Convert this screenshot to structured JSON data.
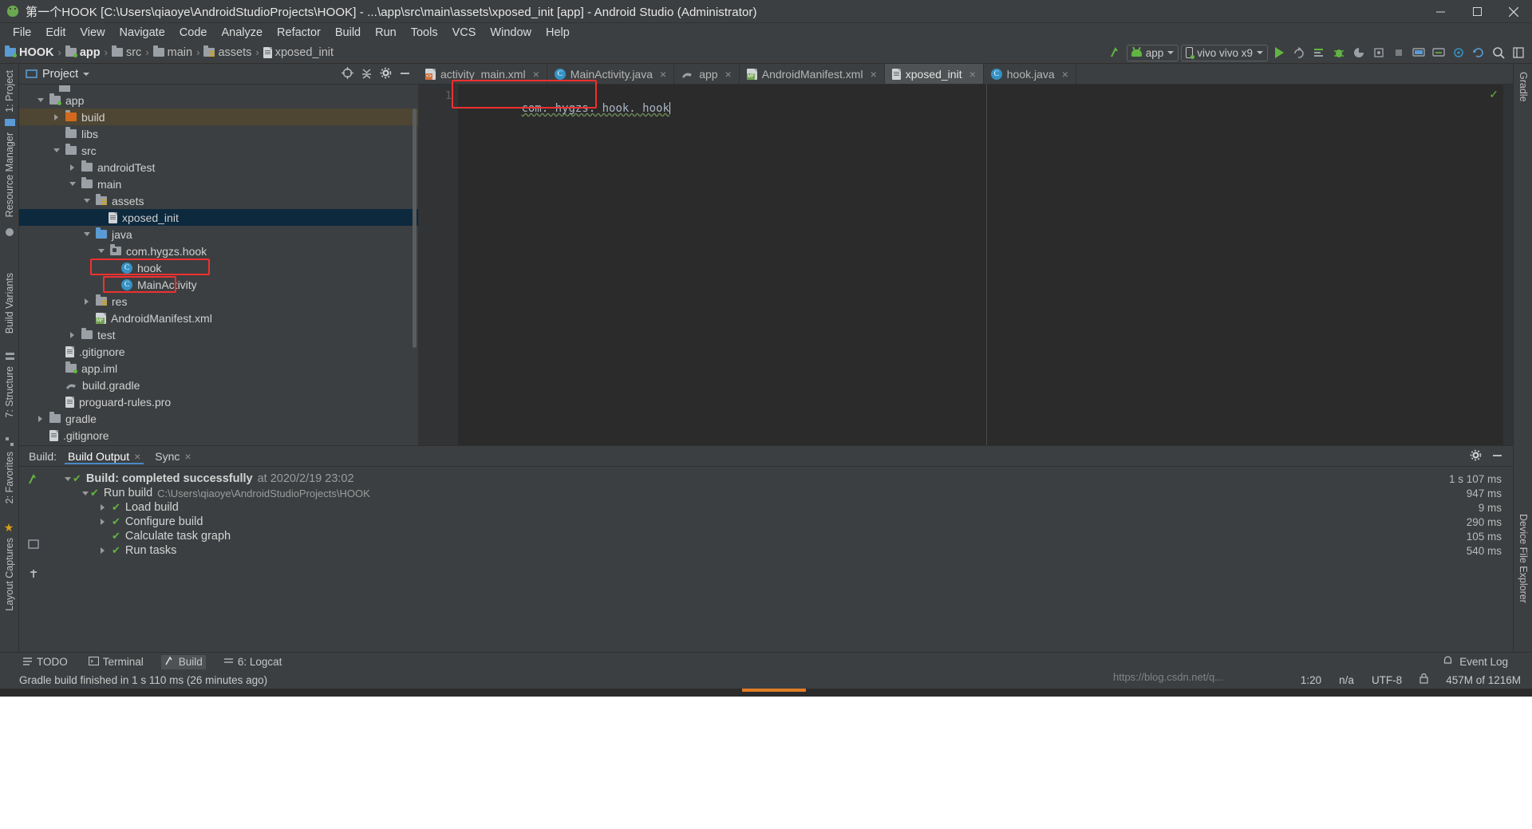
{
  "window": {
    "title": "第一个HOOK [C:\\Users\\qiaoye\\AndroidStudioProjects\\HOOK] - ...\\app\\src\\main\\assets\\xposed_init [app] - Android Studio (Administrator)",
    "app_icon": "android-studio-icon",
    "minimize_label": "Minimize",
    "maximize_label": "Maximize",
    "close_label": "Close"
  },
  "menu": {
    "items": [
      {
        "label": "File"
      },
      {
        "label": "Edit"
      },
      {
        "label": "View"
      },
      {
        "label": "Navigate"
      },
      {
        "label": "Code"
      },
      {
        "label": "Analyze"
      },
      {
        "label": "Refactor"
      },
      {
        "label": "Build"
      },
      {
        "label": "Run"
      },
      {
        "label": "Tools"
      },
      {
        "label": "VCS"
      },
      {
        "label": "Window"
      },
      {
        "label": "Help"
      }
    ]
  },
  "navbar": {
    "breadcrumbs": [
      {
        "label": "HOOK",
        "icon": "module-folder-icon"
      },
      {
        "label": "app",
        "icon": "app-module-icon"
      },
      {
        "label": "src",
        "icon": "folder-icon"
      },
      {
        "label": "main",
        "icon": "folder-icon"
      },
      {
        "label": "assets",
        "icon": "assets-folder-icon"
      },
      {
        "label": "xposed_init",
        "icon": "file-icon"
      }
    ],
    "separator": "›",
    "run_config": "app",
    "device": "vivo vivo x9",
    "actions": [
      "make-project-icon",
      "run-icon",
      "apply-changes-icon",
      "debug-icon",
      "profile-icon",
      "attach-debugger-icon",
      "stop-icon",
      "avd-manager-icon",
      "sdk-manager-icon",
      "layout-inspector-icon",
      "sync-gradle-icon",
      "search-icon",
      "project-structure-icon"
    ]
  },
  "left_strip": {
    "items": [
      {
        "label": "1: Project",
        "name": "tool-project"
      },
      {
        "label": "Resource Manager",
        "name": "tool-resource-manager"
      },
      {
        "label": "Build Variants",
        "name": "tool-build-variants"
      },
      {
        "label": "7: Structure",
        "name": "tool-structure"
      },
      {
        "label": "2: Favorites",
        "name": "tool-favorites"
      },
      {
        "label": "Layout Captures",
        "name": "tool-layout-captures"
      }
    ]
  },
  "right_strip": {
    "items": [
      {
        "label": "Gradle",
        "name": "tool-gradle"
      },
      {
        "label": "Device File Explorer",
        "name": "tool-device-file-explorer"
      }
    ]
  },
  "project_panel": {
    "title": "Project",
    "dropdown_caret": "▾",
    "header_icons": [
      "target-icon",
      "collapse-all-icon",
      "settings-icon",
      "hide-icon"
    ],
    "tree": [
      {
        "indent": 1,
        "twisty": "open",
        "icon": "app-module-icon",
        "label": "app",
        "state": "normal"
      },
      {
        "indent": 2,
        "twisty": "closed",
        "icon": "build-folder-icon",
        "label": "build",
        "state": "highlighted"
      },
      {
        "indent": 2,
        "twisty": "none",
        "icon": "folder-icon",
        "label": "libs",
        "state": "normal"
      },
      {
        "indent": 2,
        "twisty": "open",
        "icon": "folder-icon",
        "label": "src",
        "state": "normal"
      },
      {
        "indent": 3,
        "twisty": "closed",
        "icon": "folder-icon",
        "label": "androidTest",
        "state": "normal"
      },
      {
        "indent": 3,
        "twisty": "open",
        "icon": "folder-icon",
        "label": "main",
        "state": "normal"
      },
      {
        "indent": 4,
        "twisty": "open",
        "icon": "assets-folder-icon",
        "label": "assets",
        "state": "normal"
      },
      {
        "indent": 5,
        "twisty": "none",
        "icon": "file-icon",
        "label": "xposed_init",
        "state": "selected"
      },
      {
        "indent": 4,
        "twisty": "open",
        "icon": "java-folder-icon",
        "label": "java",
        "state": "normal"
      },
      {
        "indent": 5,
        "twisty": "open",
        "icon": "package-icon",
        "label": "com.hygzs.hook",
        "state": "annotated"
      },
      {
        "indent": 6,
        "twisty": "none",
        "icon": "class-icon",
        "label": "hook",
        "state": "annotated"
      },
      {
        "indent": 6,
        "twisty": "none",
        "icon": "class-icon",
        "label": "MainActivity",
        "state": "normal"
      },
      {
        "indent": 4,
        "twisty": "closed",
        "icon": "res-folder-icon",
        "label": "res",
        "state": "normal"
      },
      {
        "indent": 4,
        "twisty": "none",
        "icon": "manifest-icon",
        "label": "AndroidManifest.xml",
        "state": "normal"
      },
      {
        "indent": 3,
        "twisty": "closed",
        "icon": "folder-icon",
        "label": "test",
        "state": "normal"
      },
      {
        "indent": 2,
        "twisty": "none",
        "icon": "file-icon",
        "label": ".gitignore",
        "state": "normal"
      },
      {
        "indent": 2,
        "twisty": "none",
        "icon": "app-module-icon",
        "label": "app.iml",
        "state": "normal"
      },
      {
        "indent": 2,
        "twisty": "none",
        "icon": "gradle-icon",
        "label": "build.gradle",
        "state": "normal"
      },
      {
        "indent": 2,
        "twisty": "none",
        "icon": "file-icon",
        "label": "proguard-rules.pro",
        "state": "normal"
      },
      {
        "indent": 1,
        "twisty": "closed",
        "icon": "folder-icon",
        "label": "gradle",
        "state": "normal"
      },
      {
        "indent": 1,
        "twisty": "none",
        "icon": "file-icon",
        "label": ".gitignore",
        "state": "normal"
      }
    ]
  },
  "editor": {
    "tabs": [
      {
        "label": "activity_main.xml",
        "icon": "layout-xml-icon",
        "active": false
      },
      {
        "label": "MainActivity.java",
        "icon": "class-icon",
        "active": false
      },
      {
        "label": "app",
        "icon": "gradle-icon",
        "active": false
      },
      {
        "label": "AndroidManifest.xml",
        "icon": "manifest-icon",
        "active": false
      },
      {
        "label": "xposed_init",
        "icon": "file-icon",
        "active": true
      },
      {
        "label": "hook.java",
        "icon": "class-icon",
        "active": false
      }
    ],
    "close_glyph": "×",
    "line_number": "1",
    "content": "com. hygzs. hook. hook",
    "inspection_status": "✓"
  },
  "build_panel": {
    "label": "Build:",
    "tabs": [
      {
        "label": "Build Output",
        "active": true
      },
      {
        "label": "Sync",
        "active": false
      }
    ],
    "close_glyph": "×",
    "header_icons": [
      "settings-icon",
      "hide-icon"
    ],
    "side_icons": [
      "build-icon",
      "restart-icon",
      "pin-icon"
    ],
    "rows": [
      {
        "indent": 0,
        "twisty": "open",
        "status": "✔",
        "text": "Build: completed successfully",
        "detail": "at 2020/2/19 23:02",
        "duration": "1 s 107 ms"
      },
      {
        "indent": 1,
        "twisty": "open",
        "status": "✔",
        "text": "Run build",
        "detail": "C:\\Users\\qiaoye\\AndroidStudioProjects\\HOOK",
        "duration": "947 ms"
      },
      {
        "indent": 2,
        "twisty": "closed",
        "status": "✔",
        "text": "Load build",
        "detail": "",
        "duration": "9 ms"
      },
      {
        "indent": 2,
        "twisty": "closed",
        "status": "✔",
        "text": "Configure build",
        "detail": "",
        "duration": "290 ms"
      },
      {
        "indent": 2,
        "twisty": "none",
        "status": "✔",
        "text": "Calculate task graph",
        "detail": "",
        "duration": "105 ms"
      },
      {
        "indent": 2,
        "twisty": "closed",
        "status": "✔",
        "text": "Run tasks",
        "detail": "",
        "duration": "540 ms"
      }
    ]
  },
  "bottom_bar": {
    "items": [
      {
        "label": "TODO",
        "icon": "todo-icon",
        "active": false
      },
      {
        "label": "Terminal",
        "icon": "terminal-icon",
        "active": false
      },
      {
        "label": "Build",
        "icon": "build-icon",
        "active": true
      },
      {
        "label": "6: Logcat",
        "icon": "logcat-icon",
        "active": false
      }
    ],
    "event_log": "Event Log",
    "event_log_icon": "bell-icon"
  },
  "status_bar": {
    "message": "Gradle build finished in 1 s 110 ms (26 minutes ago)",
    "caret_position": "1:20",
    "line_separator": "n/a",
    "encoding": "UTF-8",
    "lock_icon": "lock-icon",
    "watermark": "https://blog.csdn.net/q...",
    "memory": "457M of 1216M"
  },
  "colors": {
    "accent_green": "#62b543",
    "annotation_red": "#f03030",
    "selection_blue": "#0d293e",
    "panel_bg": "#3c3f41",
    "editor_bg": "#2b2b2b"
  }
}
